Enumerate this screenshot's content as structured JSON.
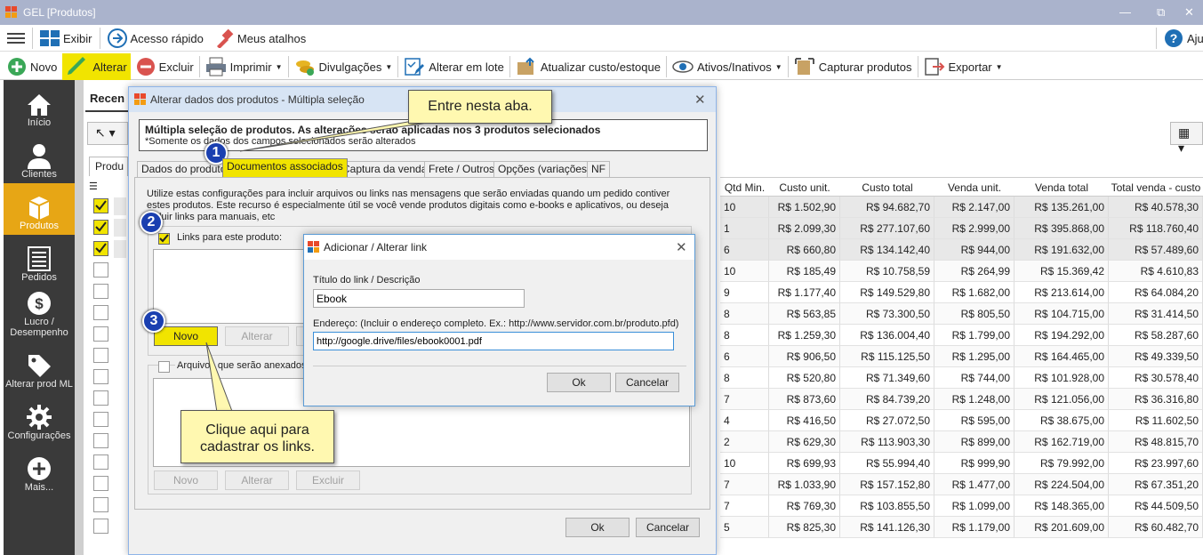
{
  "window": {
    "title": "GEL [Produtos]",
    "min": "—",
    "max": "⧉",
    "close": "✕"
  },
  "menubar": {
    "exibir": "Exibir",
    "acesso": "Acesso rápido",
    "atalhos": "Meus atalhos",
    "ajuda": "Aju"
  },
  "toolbar": {
    "novo": "Novo",
    "alterar": "Alterar",
    "excluir": "Excluir",
    "imprimir": "Imprimir",
    "divulgacoes": "Divulgações",
    "lote": "Alterar em lote",
    "atualizar": "Atualizar custo/estoque",
    "ativos": "Ativos/Inativos",
    "capturar": "Capturar produtos",
    "exportar": "Exportar"
  },
  "sidebar": {
    "items": [
      {
        "label": "Início"
      },
      {
        "label": "Clientes"
      },
      {
        "label": "Produtos"
      },
      {
        "label": "Pedidos"
      },
      {
        "label": "Lucro / Desempenho"
      },
      {
        "label": "Alterar prod ML"
      },
      {
        "label": "Configurações"
      },
      {
        "label": "Mais..."
      }
    ]
  },
  "page": {
    "recent_tab": "Recen",
    "prod_tab": "Produ"
  },
  "table": {
    "headers": [
      "Qtd Min.",
      "Custo unit.",
      "Custo total",
      "Venda unit.",
      "Venda total",
      "Total venda - custo"
    ],
    "rows": [
      [
        "10",
        "R$ 1.502,90",
        "R$ 94.682,70",
        "R$ 2.147,00",
        "R$ 135.261,00",
        "R$ 40.578,30"
      ],
      [
        "1",
        "R$ 2.099,30",
        "R$ 277.107,60",
        "R$ 2.999,00",
        "R$ 395.868,00",
        "R$ 118.760,40"
      ],
      [
        "6",
        "R$ 660,80",
        "R$ 134.142,40",
        "R$ 944,00",
        "R$ 191.632,00",
        "R$ 57.489,60"
      ],
      [
        "10",
        "R$ 185,49",
        "R$ 10.758,59",
        "R$ 264,99",
        "R$ 15.369,42",
        "R$ 4.610,83"
      ],
      [
        "9",
        "R$ 1.177,40",
        "R$ 149.529,80",
        "R$ 1.682,00",
        "R$ 213.614,00",
        "R$ 64.084,20"
      ],
      [
        "8",
        "R$ 563,85",
        "R$ 73.300,50",
        "R$ 805,50",
        "R$ 104.715,00",
        "R$ 31.414,50"
      ],
      [
        "8",
        "R$ 1.259,30",
        "R$ 136.004,40",
        "R$ 1.799,00",
        "R$ 194.292,00",
        "R$ 58.287,60"
      ],
      [
        "6",
        "R$ 906,50",
        "R$ 115.125,50",
        "R$ 1.295,00",
        "R$ 164.465,00",
        "R$ 49.339,50"
      ],
      [
        "8",
        "R$ 520,80",
        "R$ 71.349,60",
        "R$ 744,00",
        "R$ 101.928,00",
        "R$ 30.578,40"
      ],
      [
        "7",
        "R$ 873,60",
        "R$ 84.739,20",
        "R$ 1.248,00",
        "R$ 121.056,00",
        "R$ 36.316,80"
      ],
      [
        "4",
        "R$ 416,50",
        "R$ 27.072,50",
        "R$ 595,00",
        "R$ 38.675,00",
        "R$ 11.602,50"
      ],
      [
        "2",
        "R$ 629,30",
        "R$ 113.903,30",
        "R$ 899,00",
        "R$ 162.719,00",
        "R$ 48.815,70"
      ],
      [
        "10",
        "R$ 699,93",
        "R$ 55.994,40",
        "R$ 999,90",
        "R$ 79.992,00",
        "R$ 23.997,60"
      ],
      [
        "7",
        "R$ 1.033,90",
        "R$ 157.152,80",
        "R$ 1.477,00",
        "R$ 224.504,00",
        "R$ 67.351,20"
      ],
      [
        "7",
        "R$ 769,30",
        "R$ 103.855,50",
        "R$ 1.099,00",
        "R$ 148.365,00",
        "R$ 44.509,50"
      ],
      [
        "5",
        "R$ 825,30",
        "R$ 141.126,30",
        "R$ 1.179,00",
        "R$ 201.609,00",
        "R$ 60.482,70"
      ]
    ]
  },
  "dialog": {
    "title": "Alterar dados dos produtos - Múltipla seleção",
    "close": "✕",
    "info_bold": "Múltipla seleção de produtos. As alterações serão aplicadas nos 3 produtos selecionados",
    "info_note": "*Somente os dados dos campos selecionados serão alterados",
    "tabs": [
      "Dados do produto",
      "Documentos associados",
      "Captura da venda",
      "Frete / Outros",
      "Opções (variações)",
      "NF"
    ],
    "desc": "Utilize estas configurações para incluir arquivos ou links nas mensagens que serão enviadas quando um pedido contiver estes produtos. Este recurso é especialmente útil se você vende produtos digitais como e-books e aplicativos, ou deseja incluir links para manuais, etc",
    "links_label": "Links para este produto:",
    "files_label": "Arquivos que serão anexados:",
    "novo": "Novo",
    "alterar": "Alterar",
    "excluir": "Excluir",
    "ok": "Ok",
    "cancelar": "Cancelar"
  },
  "subdialog": {
    "title": "Adicionar / Alterar link",
    "close": "✕",
    "titulo_label": "Título do link / Descrição",
    "titulo_value": "Ebook",
    "endereco_label": "Endereço: (Incluir o endereço completo. Ex.: http://www.servidor.com.br/produto.pfd)",
    "endereco_value": "http://google.drive/files/ebook0001.pdf",
    "ok": "Ok",
    "cancelar": "Cancelar"
  },
  "callouts": {
    "tab_hint": "Entre nesta aba.",
    "novo_hint_1": "Clique aqui para",
    "novo_hint_2": "cadastrar os links."
  },
  "badges": [
    "1",
    "2",
    "3"
  ]
}
